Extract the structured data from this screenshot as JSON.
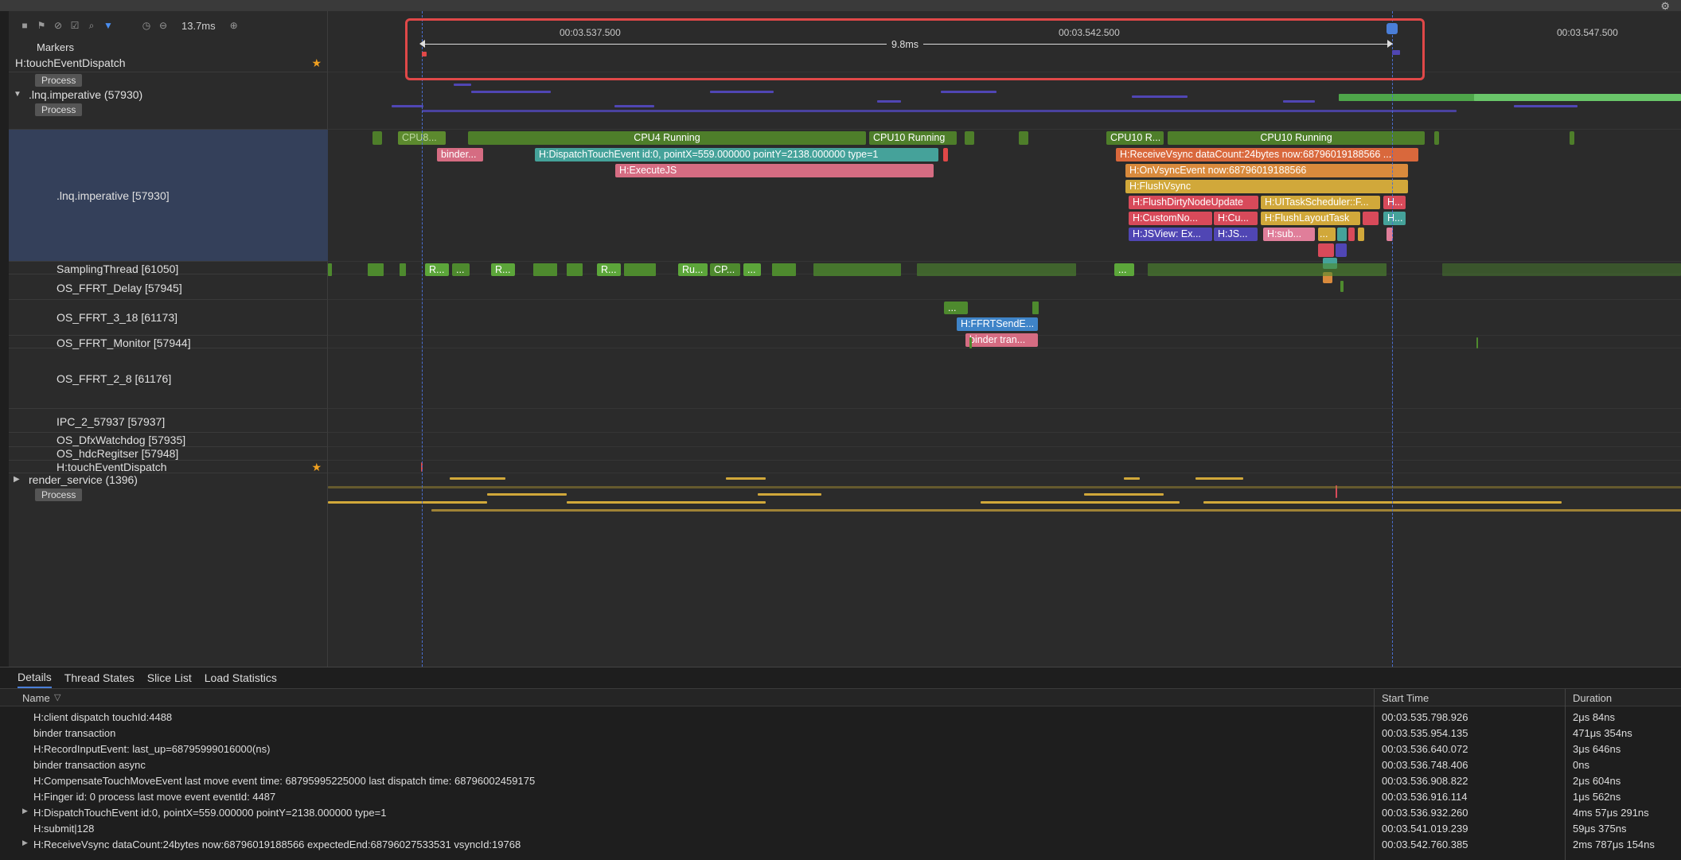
{
  "toolbar": {
    "zoom": "13.7ms"
  },
  "timeline": {
    "time_marks": [
      "00:03.537.500",
      "00:03.542.500",
      "00:03.547.500"
    ],
    "selection_duration": "9.8ms"
  },
  "rows": {
    "markers": "Markers",
    "pinned_touch": "H:touchEventDispatch",
    "process_tag": "Process",
    "proc_imperative": ".lnq.imperative (57930)",
    "main_thread": ".lnq.imperative [57930]",
    "sampling": "SamplingThread [61050]",
    "ffrt_delay": "OS_FFRT_Delay [57945]",
    "ffrt_3_18": "OS_FFRT_3_18 [61173]",
    "ffrt_monitor": "OS_FFRT_Monitor [57944]",
    "ffrt_2_8": "OS_FFRT_2_8 [61176]",
    "ipc": "IPC_2_57937 [57937]",
    "watchdog": "OS_DfxWatchdog [57935]",
    "hdc": "OS_hdcRegitser [57948]",
    "touch": "H:touchEventDispatch",
    "render_service": "render_service (1396)"
  },
  "cpu_slices": {
    "s1": "CPU8...",
    "s2": "CPU4 Running",
    "s3": "CPU10 Running",
    "s4": "CPU10 R...",
    "s5": "CPU10 Running"
  },
  "slices": {
    "binder": "binder...",
    "dispatch": "H:DispatchTouchEvent id:0, pointX=559.000000 pointY=2138.000000 type=1",
    "executejs": "H:ExecuteJS",
    "receive_vsync": "H:ReceiveVsync dataCount:24bytes now:68796019188566 ...",
    "on_vsync": "H:OnVsyncEvent now:68796019188566",
    "flush_vsync": "H:FlushVsync",
    "flush_dirty": "H:FlushDirtyNodeUpdate",
    "ui_task": "H:UITaskScheduler::F...",
    "h_short": "H...",
    "custom_no": "H:CustomNo...",
    "cu": "H:Cu...",
    "flush_layout": "H:FlushLayoutTask",
    "h_short2": "H...",
    "jsview_ex": "H:JSView: Ex...",
    "js_short": "H:JS...",
    "sub": "H:sub...",
    "dots": "...",
    "sampling_r1": "R...",
    "sampling_d1": "...",
    "sampling_r2": "R...",
    "sampling_r3": "R...",
    "sampling_ru": "Ru...",
    "sampling_cp": "CP...",
    "sampling_d2": "...",
    "sampling_d3": "...",
    "ffrt_dots": "...",
    "ffrt_send": "H:FFRTSendE...",
    "ffrt_binder": "binder tran..."
  },
  "details": {
    "tabs": [
      "Details",
      "Thread States",
      "Slice List",
      "Load Statistics"
    ],
    "columns": {
      "name": "Name",
      "start": "Start Time",
      "duration": "Duration"
    },
    "rows": [
      {
        "name": "H:client dispatch touchId:4488",
        "start": "00:03.535.798.926",
        "duration": "2μs 84ns",
        "expand": false
      },
      {
        "name": "binder transaction",
        "start": "00:03.535.954.135",
        "duration": "471μs 354ns",
        "expand": false
      },
      {
        "name": "H:RecordInputEvent: last_up=68795999016000(ns)",
        "start": "00:03.536.640.072",
        "duration": "3μs 646ns",
        "expand": false
      },
      {
        "name": "binder transaction async",
        "start": "00:03.536.748.406",
        "duration": "0ns",
        "expand": false
      },
      {
        "name": "H:CompensateTouchMoveEvent last move event time: 68795995225000 last dispatch time: 68796002459175",
        "start": "00:03.536.908.822",
        "duration": "2μs 604ns",
        "expand": false
      },
      {
        "name": "H:Finger id: 0 process last move event eventId: 4487",
        "start": "00:03.536.916.114",
        "duration": "1μs 562ns",
        "expand": false
      },
      {
        "name": "H:DispatchTouchEvent id:0, pointX=559.000000 pointY=2138.000000 type=1",
        "start": "00:03.536.932.260",
        "duration": "4ms 57μs 291ns",
        "expand": true
      },
      {
        "name": "H:submit|128",
        "start": "00:03.541.019.239",
        "duration": "59μs 375ns",
        "expand": false
      },
      {
        "name": "H:ReceiveVsync dataCount:24bytes now:68796019188566 expectedEnd:68796027533531 vsyncId:19768",
        "start": "00:03.542.760.385",
        "duration": "2ms 787μs 154ns",
        "expand": true
      }
    ]
  },
  "colors": {
    "cpu_green": "#4e7e2a",
    "purple": "#5046b4",
    "pink": "#d56c82",
    "teal": "#45a29a",
    "orange": "#d98a3c",
    "yellow": "#d1a83a",
    "selection_red": "#e04848"
  }
}
